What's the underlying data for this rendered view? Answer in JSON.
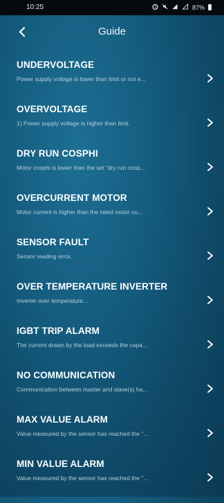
{
  "status_bar": {
    "time": "10:25",
    "icons": [
      "alarm-icon",
      "mute-icon",
      "signal-icon",
      "wifi-icon"
    ],
    "battery": "87%"
  },
  "header": {
    "title": "Guide",
    "back_icon": "chevron-left-icon"
  },
  "items": [
    {
      "title": "UNDERVOLTAGE",
      "subtitle": "Power supply voltage is lower than limit or not e..."
    },
    {
      "title": "OVERVOLTAGE",
      "subtitle": "1) Power supply voltage is higher than limit."
    },
    {
      "title": "DRY RUN COSPHI",
      "subtitle": "Motor cosphi is lower than the set \"dry run cosp..."
    },
    {
      "title": "OVERCURRENT MOTOR",
      "subtitle": "Motor current is higher than the rated motor cu..."
    },
    {
      "title": "SENSOR FAULT",
      "subtitle": "Sensor reading error."
    },
    {
      "title": "OVER TEMPERATURE INVERTER",
      "subtitle": "Inverter over temperature..."
    },
    {
      "title": "IGBT TRIP ALARM",
      "subtitle": "The current drawn by the load exceeds the capa..."
    },
    {
      "title": "NO COMMUNICATION",
      "subtitle": "Communication between master and slave(s) ha..."
    },
    {
      "title": "MAX VALUE ALARM",
      "subtitle": "Value measured by the sensor has reached the \"..."
    },
    {
      "title": "MIN VALUE ALARM",
      "subtitle": "Value measured by the sensor has reached the \"..."
    }
  ],
  "colors": {
    "background": "#155d80",
    "status_bar": "#050a0d",
    "subtitle": "#b9cfdb"
  }
}
